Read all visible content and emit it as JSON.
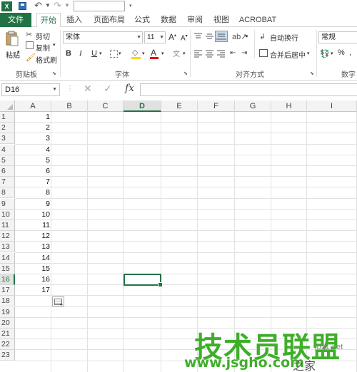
{
  "qat": {
    "app_icon": "X",
    "icons": [
      "excel-icon",
      "save-icon",
      "undo-icon",
      "redo-icon",
      "dropdown-icon"
    ]
  },
  "tabs": [
    {
      "label": "文件"
    },
    {
      "label": "开始"
    },
    {
      "label": "插入"
    },
    {
      "label": "页面布局"
    },
    {
      "label": "公式"
    },
    {
      "label": "数据"
    },
    {
      "label": "审阅"
    },
    {
      "label": "视图"
    },
    {
      "label": "ACROBAT"
    }
  ],
  "ribbon": {
    "clipboard": {
      "paste": "粘贴",
      "cut": "剪切",
      "copy": "复制",
      "format_painter": "格式刷",
      "group_label": "剪贴板"
    },
    "font": {
      "font_name": "宋体",
      "font_size": "11",
      "grow": "A",
      "shrink": "A",
      "bold": "B",
      "italic": "I",
      "underline": "U",
      "group_label": "字体"
    },
    "alignment": {
      "wrap_text": "自动换行",
      "merge_center": "合并后居中",
      "group_label": "对齐方式"
    },
    "number": {
      "format": "常规",
      "percent": "%",
      "group_label": "数字"
    }
  },
  "formula_bar": {
    "name_box": "D16",
    "cancel": "✕",
    "enter": "✓",
    "fx": "fx",
    "dots": "⋮",
    "value": ""
  },
  "sheet": {
    "columns": [
      "A",
      "B",
      "C",
      "D",
      "E",
      "F",
      "G",
      "H",
      "I"
    ],
    "selected_column": "D",
    "rows": [
      "1",
      "2",
      "3",
      "4",
      "5",
      "6",
      "7",
      "8",
      "9",
      "10",
      "11",
      "12",
      "13",
      "14",
      "15",
      "16",
      "17",
      "18",
      "19",
      "20",
      "21",
      "22",
      "23"
    ],
    "selected_row": "16",
    "column_a_values": [
      "1",
      "2",
      "3",
      "4",
      "5",
      "6",
      "7",
      "8",
      "9",
      "10",
      "11",
      "12",
      "13",
      "14",
      "15",
      "16",
      "17"
    ],
    "active_cell": "D16"
  },
  "watermark": {
    "brand": "技术员联盟",
    "url": "www.jsgho.com",
    "site": "jb51.net",
    "corner": "之家"
  },
  "colors": {
    "accent": "#217346",
    "watermark": "#3fae2a"
  }
}
